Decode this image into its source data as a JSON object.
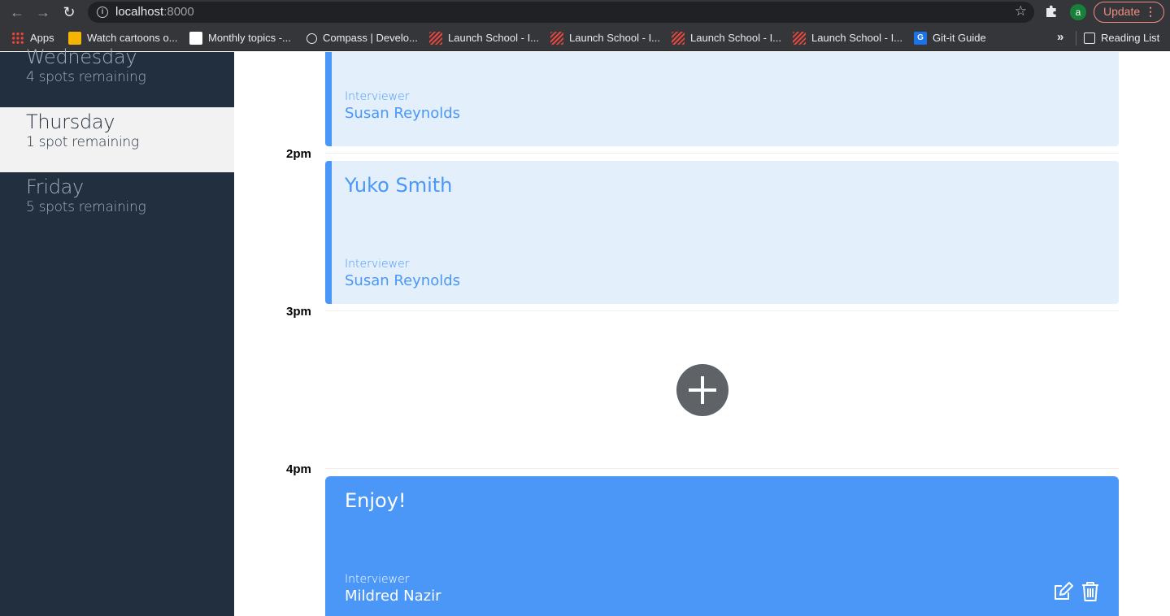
{
  "browser": {
    "url_host": "localhost",
    "url_port": ":8000",
    "profile_initial": "a",
    "update_label": "Update",
    "bookmarks": [
      {
        "label": "Apps",
        "icon": "apps-icon"
      },
      {
        "label": "Watch cartoons o...",
        "icon": "cartoon-icon"
      },
      {
        "label": "Monthly topics -...",
        "icon": "doc-icon"
      },
      {
        "label": "Compass | Develo...",
        "icon": "compass-icon"
      },
      {
        "label": "Launch School - I...",
        "icon": "launch-school-icon"
      },
      {
        "label": "Launch School - I...",
        "icon": "launch-school-icon"
      },
      {
        "label": "Launch School - I...",
        "icon": "launch-school-icon"
      },
      {
        "label": "Launch School - I...",
        "icon": "launch-school-icon"
      },
      {
        "label": "Git-it Guide",
        "icon": "git-it-icon"
      }
    ],
    "reading_list": "Reading List"
  },
  "sidebar": {
    "days": [
      {
        "name": "Wednesday",
        "spots": "4 spots remaining",
        "selected": false
      },
      {
        "name": "Thursday",
        "spots": "1 spot remaining",
        "selected": true
      },
      {
        "name": "Friday",
        "spots": "5 spots remaining",
        "selected": false
      }
    ]
  },
  "schedule": {
    "times": [
      "2pm",
      "3pm",
      "4pm"
    ],
    "appointments": [
      {
        "student": "",
        "interviewer_label": "Interviewer",
        "interviewer": "Susan Reynolds"
      },
      {
        "student": "Yuko Smith",
        "interviewer_label": "Interviewer",
        "interviewer": "Susan Reynolds"
      },
      {
        "student": "Enjoy!",
        "interviewer_label": "Interviewer",
        "interviewer": "Mildred Nazir"
      }
    ]
  },
  "colors": {
    "sidebar_bg": "#222f3e",
    "selected_day_bg": "#f2f2f2",
    "accent_blue": "#4a97f8",
    "appointment_bg": "#e3f0fc",
    "add_button": "#5f6368",
    "update_red": "#f28b82"
  }
}
